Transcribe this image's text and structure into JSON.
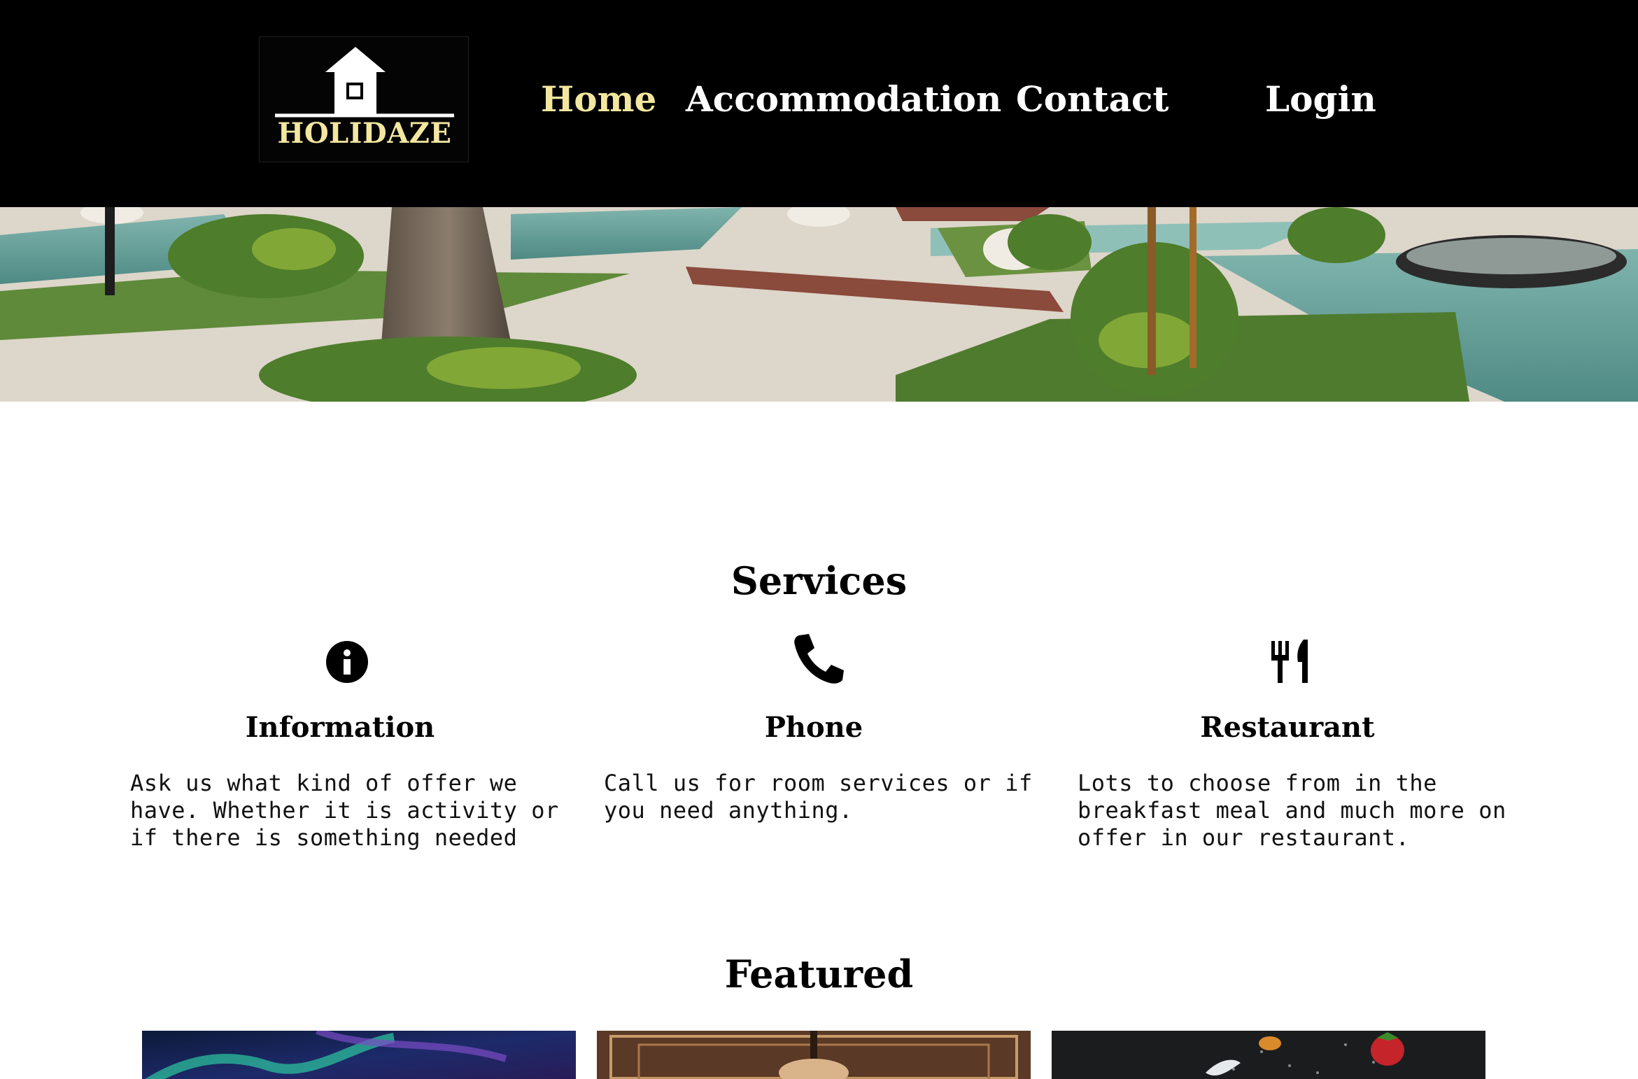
{
  "brand": {
    "logo_text": "HOLIDAZE",
    "accent_color": "#f3e7a0",
    "header_bg": "#000000"
  },
  "nav": {
    "home": "Home",
    "accommodation": "Accommodation",
    "contact": "Contact",
    "login": "Login"
  },
  "services": {
    "title": "Services",
    "items": [
      {
        "icon": "info-icon",
        "title": "Information",
        "text": "Ask us what kind of offer we have. Whether it is activity or if there is something needed"
      },
      {
        "icon": "phone-icon",
        "title": "Phone",
        "text": "Call us for room services or if you need anything."
      },
      {
        "icon": "fork-knife-icon",
        "title": "Restaurant",
        "text": "Lots to choose from in the breakfast meal and much more on offer in our restaurant."
      }
    ]
  },
  "featured": {
    "title": "Featured",
    "cards": [
      {
        "image": "aurora-night-sky"
      },
      {
        "image": "ornate-hotel-ceiling"
      },
      {
        "image": "food-dark-table"
      }
    ]
  }
}
